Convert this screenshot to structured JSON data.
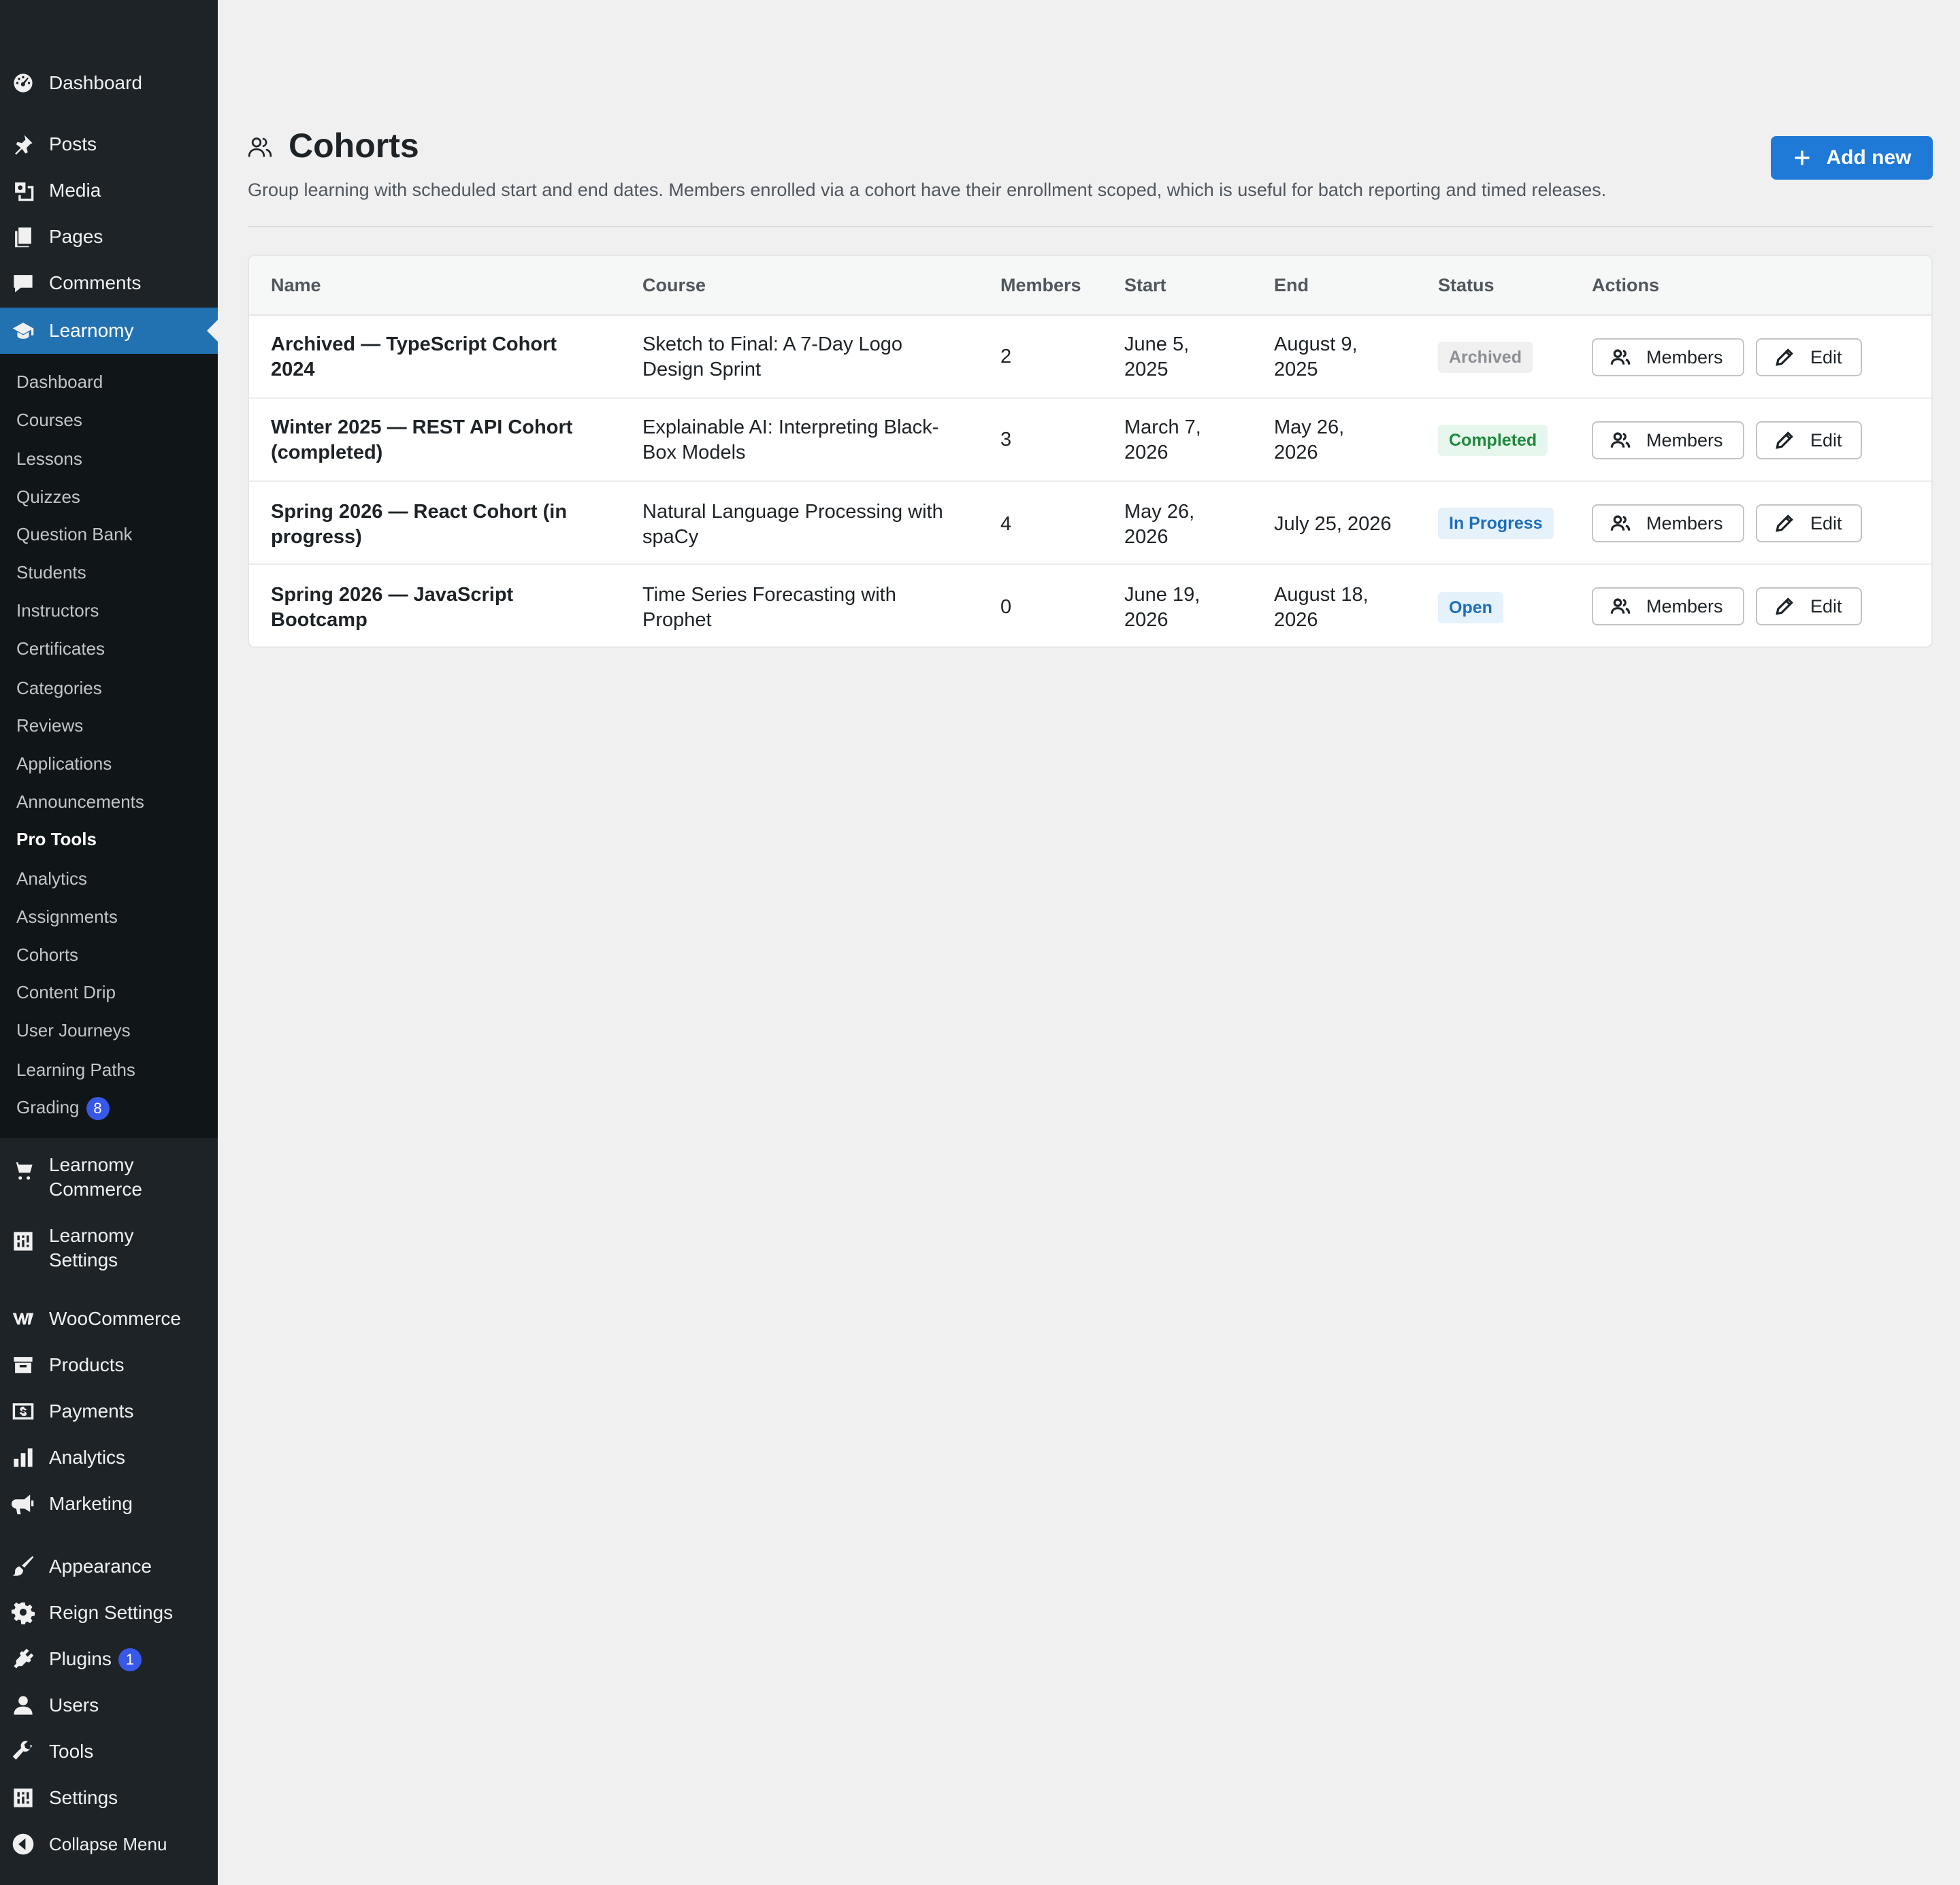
{
  "sidebar": {
    "top_items": [
      {
        "label": "Dashboard",
        "icon": "dashboard-icon"
      },
      {
        "label": "Posts",
        "icon": "pin-icon"
      },
      {
        "label": "Media",
        "icon": "media-icon"
      },
      {
        "label": "Pages",
        "icon": "pages-icon"
      },
      {
        "label": "Comments",
        "icon": "comment-icon"
      },
      {
        "label": "Learnomy",
        "icon": "graduation-cap-icon"
      }
    ],
    "submenu": [
      "Dashboard",
      "Courses",
      "Lessons",
      "Quizzes",
      "Question Bank",
      "Students",
      "Instructors",
      "Certificates",
      "Categories",
      "Reviews",
      "Applications",
      "Announcements",
      "Pro Tools",
      "Analytics",
      "Assignments",
      "Cohorts",
      "Content Drip",
      "User Journeys",
      "Learning Paths",
      "Grading"
    ],
    "grading_badge": "8",
    "bottom_items": [
      {
        "label_line1": "Learnomy",
        "label_line2": "Commerce",
        "icon": "cart-icon"
      },
      {
        "label_line1": "Learnomy",
        "label_line2": "Settings",
        "icon": "settings-sliders-icon"
      },
      {
        "label": "WooCommerce",
        "icon": "woocommerce-icon"
      },
      {
        "label": "Products",
        "icon": "archive-icon"
      },
      {
        "label": "Payments",
        "icon": "dollar-icon"
      },
      {
        "label": "Analytics",
        "icon": "bar-chart-icon"
      },
      {
        "label": "Marketing",
        "icon": "megaphone-icon"
      },
      {
        "label": "Appearance",
        "icon": "brush-icon"
      },
      {
        "label": "Reign Settings",
        "icon": "gear-icon"
      },
      {
        "label": "Plugins",
        "icon": "plugin-icon"
      },
      {
        "label": "Users",
        "icon": "user-icon"
      },
      {
        "label": "Tools",
        "icon": "wrench-icon"
      },
      {
        "label": "Settings",
        "icon": "settings-sliders-icon"
      },
      {
        "label": "Collapse Menu",
        "icon": "collapse-icon"
      }
    ],
    "plugins_badge": "1"
  },
  "header": {
    "title": "Cohorts",
    "description": "Group learning with scheduled start and end dates. Members enrolled via a cohort have their enrollment scoped, which is useful for batch reporting and timed releases.",
    "add_new_label": "Add new"
  },
  "table": {
    "columns": [
      "Name",
      "Course",
      "Members",
      "Start",
      "End",
      "Status",
      "Actions"
    ],
    "rows": [
      {
        "name_1": "Archived — TypeScript Cohort",
        "name_2": "2024",
        "course_1": "Sketch to Final: A 7-Day Logo",
        "course_2": "Design Sprint",
        "members": "2",
        "start_1": "June 5,",
        "start_2": "2025",
        "end_1": "August 9,",
        "end_2": "2025",
        "status": "Archived"
      },
      {
        "name_1": "Winter 2025 — REST API Cohort",
        "name_2": "(completed)",
        "course_1": "Explainable AI: Interpreting Black-",
        "course_2": "Box Models",
        "members": "3",
        "start_1": "March 7,",
        "start_2": "2026",
        "end_1": "May 26,",
        "end_2": "2026",
        "status": "Completed"
      },
      {
        "name_1": "Spring 2026 — React Cohort (in",
        "name_2": "progress)",
        "course_1": "Natural Language Processing with",
        "course_2": "spaCy",
        "members": "4",
        "start_1": "May 26,",
        "start_2": "2026",
        "end_1": "July 25, 2026",
        "end_2": "",
        "status": "In Progress"
      },
      {
        "name_1": "Spring 2026 — JavaScript",
        "name_2": "Bootcamp",
        "course_1": "Time Series Forecasting with",
        "course_2": "Prophet",
        "members": "0",
        "start_1": "June 19,",
        "start_2": "2026",
        "end_1": "August 18,",
        "end_2": "2026",
        "status": "Open"
      }
    ],
    "members_button_label": "Members",
    "edit_button_label": "Edit"
  },
  "colors": {
    "sidebar_bg": "#1d2327",
    "submenu_bg": "#101517",
    "active_bg": "#2271b1",
    "primary_button": "#1e7ad6",
    "badge": "#3858e9"
  }
}
